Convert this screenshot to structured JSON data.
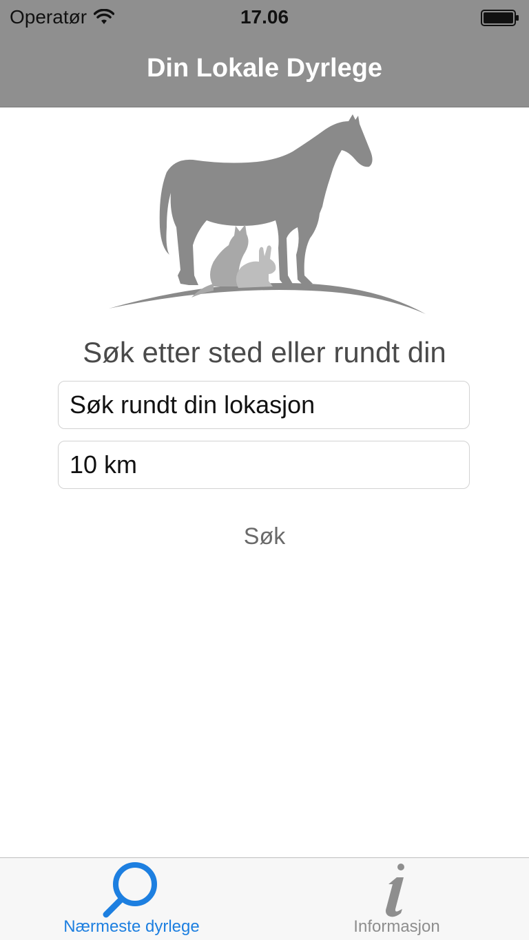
{
  "status_bar": {
    "carrier": "Operatør",
    "time": "17.06",
    "wifi_icon": "wifi-icon",
    "battery_icon": "battery-icon"
  },
  "nav": {
    "title": "Din Lokale Dyrlege"
  },
  "logo": {
    "icon": "animals-silhouette-logo"
  },
  "search": {
    "prompt": "Søk etter sted eller rundt din",
    "location_value": "Søk rundt din lokasjon",
    "radius_value": "10 km",
    "button_label": "Søk"
  },
  "tabs": [
    {
      "label": "Nærmeste dyrlege",
      "icon": "search-icon",
      "selected": true
    },
    {
      "label": "Informasjon",
      "icon": "info-icon",
      "selected": false
    }
  ],
  "colors": {
    "nav_bar": "#8f8f8f",
    "accent": "#1d7fe0",
    "logo": "#8a8a8a"
  }
}
